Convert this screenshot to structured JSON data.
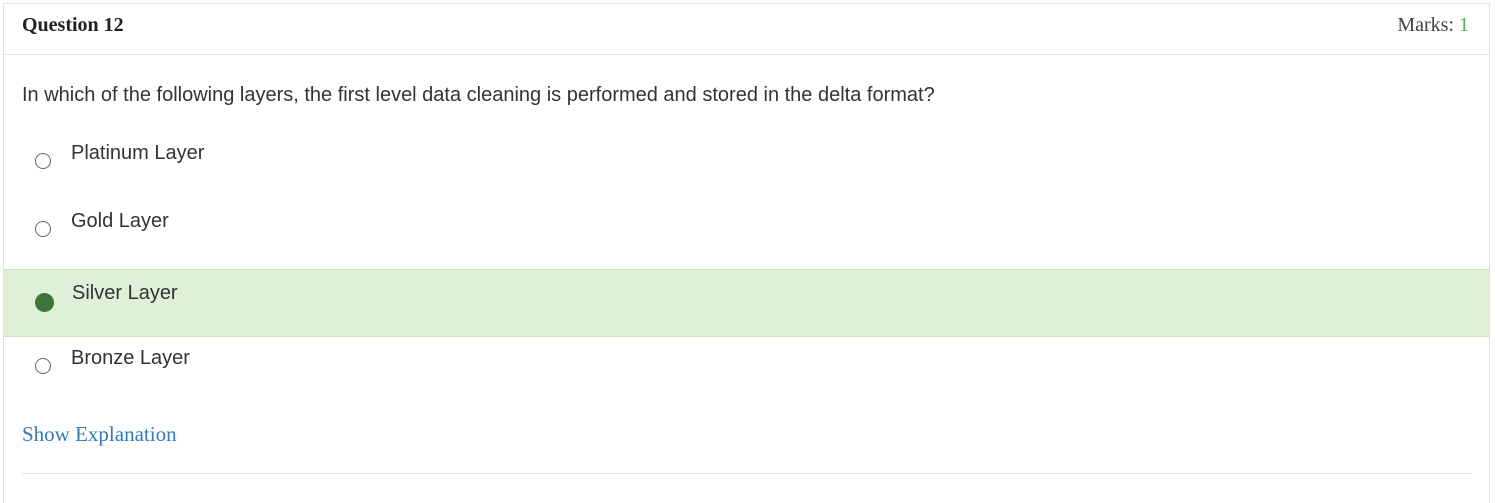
{
  "question": {
    "title": "Question 12",
    "marks_label": "Marks:",
    "marks_value": "1",
    "text": "In which of the following layers, the first level data cleaning is performed and stored in the delta format?"
  },
  "options": [
    {
      "label": "Platinum Layer",
      "selected": false
    },
    {
      "label": "Gold Layer",
      "selected": false
    },
    {
      "label": "Silver Layer",
      "selected": true
    },
    {
      "label": "Bronze Layer",
      "selected": false
    }
  ],
  "footer": {
    "explanation_link": "Show Explanation"
  },
  "colors": {
    "selected_background": "#dff0d8",
    "selected_radio": "#3c763d",
    "marks_value": "#4caf50",
    "link": "#337ab7"
  }
}
